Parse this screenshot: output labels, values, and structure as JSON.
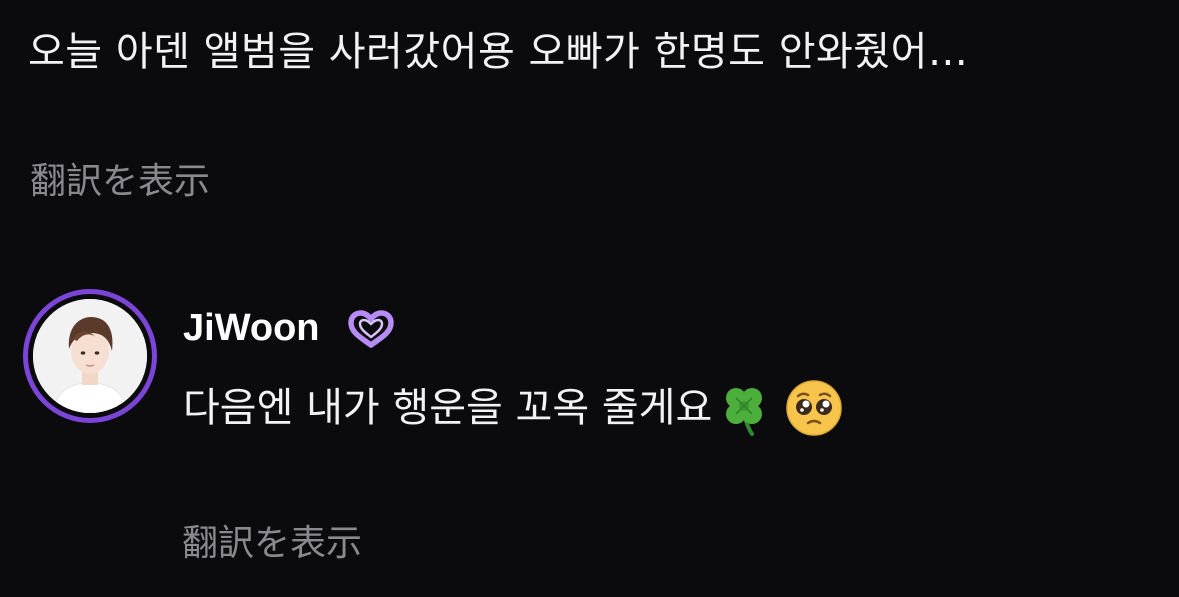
{
  "fan_comment": {
    "text": "오늘 아덴 앨범을 사러갔어용 오빠가 한명도 안와줬어…",
    "translate_label": "翻訳を表示"
  },
  "artist_reply": {
    "name": "JiWoon",
    "badge_icon": "purple-heart-ring-icon",
    "text": "다음엔 내가 행운을 꼬옥 줄게요",
    "emojis": [
      "four-leaf-clover-icon",
      "pleading-face-icon"
    ],
    "translate_label": "翻訳を表示"
  },
  "colors": {
    "background": "#0b0b0e",
    "text": "#f2f2f2",
    "muted": "#8a8a8e",
    "avatar_ring": "#7b45d8",
    "badge": "#b78cf5"
  }
}
